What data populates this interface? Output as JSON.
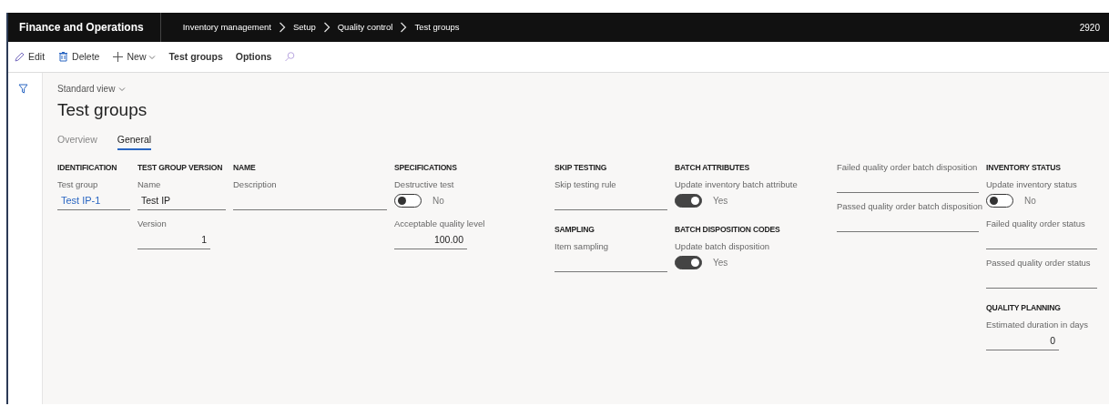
{
  "topbar": {
    "app_title": "Finance and Operations",
    "breadcrumb": [
      "Inventory management",
      "Setup",
      "Quality control",
      "Test groups"
    ],
    "company": "2920"
  },
  "toolbar": [
    {
      "kind": "edit",
      "label": "Edit"
    },
    {
      "kind": "delete",
      "label": "Delete"
    },
    {
      "kind": "new",
      "label": "New"
    },
    {
      "kind": "plain",
      "label": "Test groups"
    },
    {
      "kind": "plain",
      "label": "Options"
    },
    {
      "kind": "search"
    }
  ],
  "view": "Standard view",
  "page_title": "Test groups",
  "tabs": [
    {
      "label": "Overview",
      "selected": false
    },
    {
      "label": "General",
      "selected": true
    }
  ],
  "columns": [
    [
      {
        "heading": "IDENTIFICATION",
        "fields": [
          {
            "kind": "link",
            "label": "Test group",
            "value": "Test IP-1"
          }
        ]
      }
    ],
    [
      {
        "heading": "TEST GROUP VERSION",
        "fields": [
          {
            "kind": "text",
            "label": "Name",
            "value": "Test IP"
          },
          {
            "kind": "number",
            "label": "Version",
            "value": "1"
          }
        ]
      }
    ],
    [
      {
        "heading": "NAME",
        "fields": [
          {
            "kind": "text",
            "label": "Description"
          }
        ]
      }
    ],
    [
      {
        "heading": "SPECIFICATIONS",
        "fields": [
          {
            "kind": "toggle",
            "label": "Destructive test",
            "on": false,
            "value": "No"
          },
          {
            "kind": "number",
            "label": "Acceptable quality level",
            "value": "100.00"
          }
        ]
      }
    ],
    [
      {
        "heading": "SKIP TESTING",
        "fields": [
          {
            "kind": "text",
            "label": "Skip testing rule"
          }
        ]
      },
      {
        "heading": "SAMPLING",
        "fields": [
          {
            "kind": "text",
            "label": "Item sampling"
          }
        ]
      }
    ],
    [
      {
        "heading": "BATCH ATTRIBUTES",
        "fields": [
          {
            "kind": "toggle",
            "label": "Update inventory batch attribute",
            "on": true,
            "value": "Yes"
          }
        ]
      },
      {
        "heading": "BATCH DISPOSITION CODES",
        "fields": [
          {
            "kind": "toggle",
            "label": "Update batch disposition",
            "on": true,
            "value": "Yes"
          }
        ]
      }
    ],
    [
      {
        "fields": [
          {
            "kind": "text",
            "label": "Failed quality order batch disposition"
          },
          {
            "kind": "text",
            "label": "Passed quality order batch disposition"
          }
        ]
      }
    ],
    [
      {
        "heading": "INVENTORY STATUS",
        "fields": [
          {
            "kind": "toggle",
            "label": "Update inventory status",
            "on": false,
            "value": "No"
          },
          {
            "kind": "text",
            "label": "Failed quality order status"
          },
          {
            "kind": "text",
            "label": "Passed quality order status"
          }
        ]
      },
      {
        "heading": "QUALITY PLANNING",
        "fields": [
          {
            "kind": "number",
            "label": "Estimated duration in days",
            "value": "0"
          }
        ]
      }
    ]
  ]
}
